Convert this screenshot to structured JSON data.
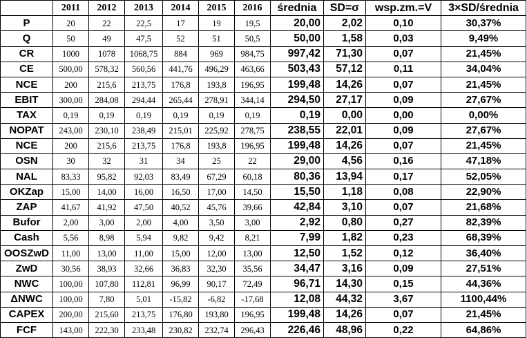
{
  "header": {
    "corner": "",
    "years": [
      "2011",
      "2012",
      "2013",
      "2014",
      "2015",
      "2016"
    ],
    "stats": [
      "średnia",
      "SD=σ",
      "wsp.zm.=V",
      "3×SD/średnia"
    ]
  },
  "rows": [
    {
      "label": "P",
      "values": [
        "20",
        "22",
        "22,5",
        "17",
        "19",
        "19,5"
      ],
      "stats": [
        "20,00",
        "2,02",
        "0,10",
        "30,37%"
      ]
    },
    {
      "label": "Q",
      "values": [
        "50",
        "49",
        "47,5",
        "52",
        "51",
        "50,5"
      ],
      "stats": [
        "50,00",
        "1,58",
        "0,03",
        "9,49%"
      ]
    },
    {
      "label": "CR",
      "values": [
        "1000",
        "1078",
        "1068,75",
        "884",
        "969",
        "984,75"
      ],
      "stats": [
        "997,42",
        "71,30",
        "0,07",
        "21,45%"
      ]
    },
    {
      "label": "CE",
      "values": [
        "500,00",
        "578,32",
        "560,56",
        "441,76",
        "496,29",
        "463,66"
      ],
      "stats": [
        "503,43",
        "57,12",
        "0,11",
        "34,04%"
      ]
    },
    {
      "label": "NCE",
      "values": [
        "200",
        "215,6",
        "213,75",
        "176,8",
        "193,8",
        "196,95"
      ],
      "stats": [
        "199,48",
        "14,26",
        "0,07",
        "21,45%"
      ]
    },
    {
      "label": "EBIT",
      "values": [
        "300,00",
        "284,08",
        "294,44",
        "265,44",
        "278,91",
        "344,14"
      ],
      "stats": [
        "294,50",
        "27,17",
        "0,09",
        "27,67%"
      ]
    },
    {
      "label": "TAX",
      "values": [
        "0,19",
        "0,19",
        "0,19",
        "0,19",
        "0,19",
        "0,19"
      ],
      "stats": [
        "0,19",
        "0,00",
        "0,00",
        "0,00%"
      ]
    },
    {
      "label": "NOPAT",
      "values": [
        "243,00",
        "230,10",
        "238,49",
        "215,01",
        "225,92",
        "278,75"
      ],
      "stats": [
        "238,55",
        "22,01",
        "0,09",
        "27,67%"
      ]
    },
    {
      "label": "NCE",
      "values": [
        "200",
        "215,6",
        "213,75",
        "176,8",
        "193,8",
        "196,95"
      ],
      "stats": [
        "199,48",
        "14,26",
        "0,07",
        "21,45%"
      ]
    },
    {
      "label": "OSN",
      "values": [
        "30",
        "32",
        "31",
        "34",
        "25",
        "22"
      ],
      "stats": [
        "29,00",
        "4,56",
        "0,16",
        "47,18%"
      ]
    },
    {
      "label": "NAL",
      "values": [
        "83,33",
        "95,82",
        "92,03",
        "83,49",
        "67,29",
        "60,18"
      ],
      "stats": [
        "80,36",
        "13,94",
        "0,17",
        "52,05%"
      ]
    },
    {
      "label": "OKZap",
      "values": [
        "15,00",
        "14,00",
        "16,00",
        "16,50",
        "17,00",
        "14,50"
      ],
      "stats": [
        "15,50",
        "1,18",
        "0,08",
        "22,90%"
      ]
    },
    {
      "label": "ZAP",
      "values": [
        "41,67",
        "41,92",
        "47,50",
        "40,52",
        "45,76",
        "39,66"
      ],
      "stats": [
        "42,84",
        "3,10",
        "0,07",
        "21,68%"
      ]
    },
    {
      "label": "Bufor",
      "values": [
        "2,00",
        "3,00",
        "2,00",
        "4,00",
        "3,50",
        "3,00"
      ],
      "stats": [
        "2,92",
        "0,80",
        "0,27",
        "82,39%"
      ]
    },
    {
      "label": "Cash",
      "values": [
        "5,56",
        "8,98",
        "5,94",
        "9,82",
        "9,42",
        "8,21"
      ],
      "stats": [
        "7,99",
        "1,82",
        "0,23",
        "68,39%"
      ]
    },
    {
      "label": "OOSZwD",
      "values": [
        "11,00",
        "13,00",
        "11,00",
        "15,00",
        "12,00",
        "13,00"
      ],
      "stats": [
        "12,50",
        "1,52",
        "0,12",
        "36,40%"
      ]
    },
    {
      "label": "ZwD",
      "values": [
        "30,56",
        "38,93",
        "32,66",
        "36,83",
        "32,30",
        "35,56"
      ],
      "stats": [
        "34,47",
        "3,16",
        "0,09",
        "27,51%"
      ]
    },
    {
      "label": "NWC",
      "values": [
        "100,00",
        "107,80",
        "112,81",
        "96,99",
        "90,17",
        "72,49"
      ],
      "stats": [
        "96,71",
        "14,30",
        "0,15",
        "44,36%"
      ]
    },
    {
      "label": "ΔNWC",
      "values": [
        "100,00",
        "7,80",
        "5,01",
        "-15,82",
        "-6,82",
        "-17,68"
      ],
      "stats": [
        "12,08",
        "44,32",
        "3,67",
        "1100,44%"
      ]
    },
    {
      "label": "CAPEX",
      "values": [
        "200,00",
        "215,60",
        "213,75",
        "176,80",
        "193,80",
        "196,95"
      ],
      "stats": [
        "199,48",
        "14,26",
        "0,07",
        "21,45%"
      ]
    },
    {
      "label": "FCF",
      "values": [
        "143,00",
        "222,30",
        "233,48",
        "230,82",
        "232,74",
        "296,43"
      ],
      "stats": [
        "226,46",
        "48,96",
        "0,22",
        "64,86%"
      ]
    }
  ]
}
